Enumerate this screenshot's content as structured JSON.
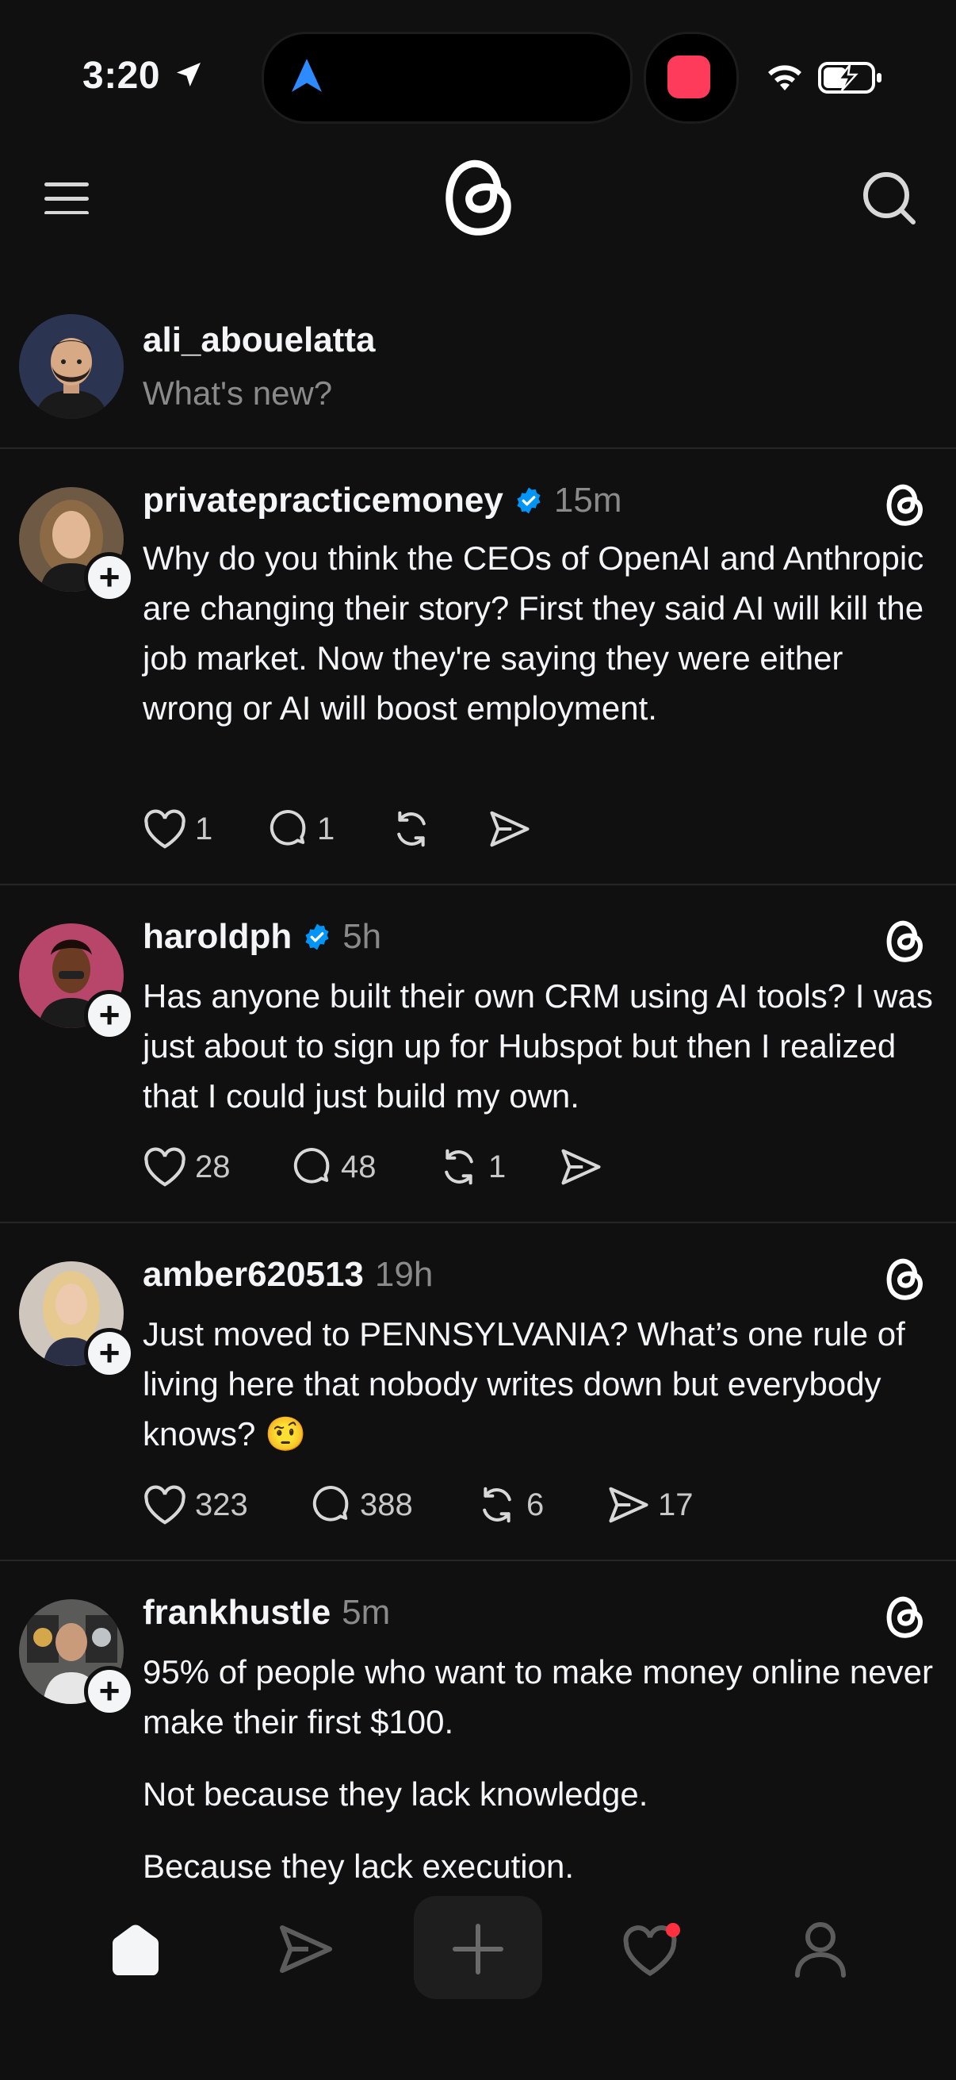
{
  "status_bar": {
    "time": "3:20"
  },
  "composer": {
    "username": "ali_abouelatta",
    "placeholder": "What's new?"
  },
  "posts": [
    {
      "username": "privatepracticemoney",
      "verified": true,
      "time": "15m",
      "paragraphs": [
        "Why do you think the CEOs of OpenAI and Anthropic are changing their story? First they said AI will kill the job market. Now they're saying they were either wrong or AI will boost employment."
      ],
      "likes": "1",
      "replies": "1",
      "reposts": "",
      "shares": ""
    },
    {
      "username": "haroldph",
      "verified": true,
      "time": "5h",
      "paragraphs": [
        "Has anyone built their own CRM using AI tools? I was just about to sign up for Hubspot but then I realized that I could just build my own."
      ],
      "likes": "28",
      "replies": "48",
      "reposts": "1",
      "shares": ""
    },
    {
      "username": "amber620513",
      "verified": false,
      "time": "19h",
      "paragraphs": [
        "Just moved to PENNSYLVANIA? What’s one rule of living here that nobody writes down but everybody knows? 🤨"
      ],
      "likes": "323",
      "replies": "388",
      "reposts": "6",
      "shares": "17"
    },
    {
      "username": "frankhustle",
      "verified": false,
      "time": "5m",
      "paragraphs": [
        "95% of people who want to make money online never make their first $100.",
        "Not because they lack knowledge.",
        "Because they lack execution."
      ]
    }
  ],
  "colors": {
    "background": "#101010",
    "verified": "#0095f6",
    "notification": "#ff3040"
  },
  "nav": {
    "items": [
      "home-icon",
      "send-icon",
      "plus-icon",
      "heart-icon",
      "profile-icon"
    ]
  }
}
